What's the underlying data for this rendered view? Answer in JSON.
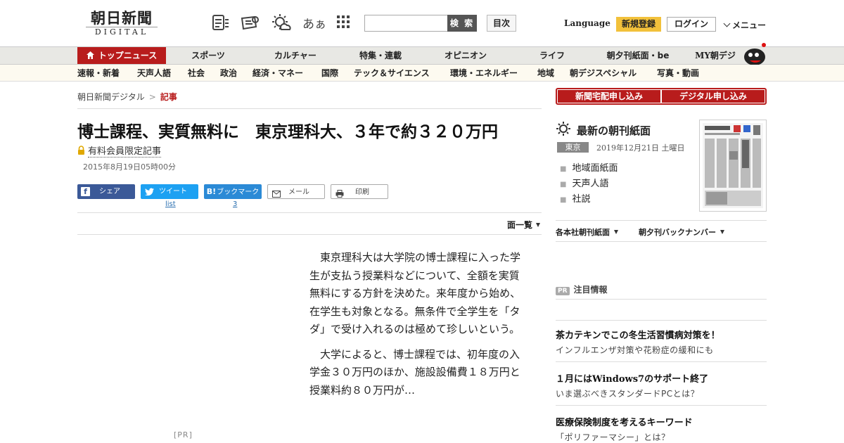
{
  "header": {
    "logo_jp": "朝日新聞",
    "logo_en": "DIGITAL",
    "search_placeholder": "",
    "search_button": "検 索",
    "toc_button": "目次",
    "language": "Language",
    "register": "新規登録",
    "login": "ログイン",
    "menu": "メニュー",
    "font_size_glyph": "あぁ"
  },
  "nav_primary": [
    {
      "label": "トップニュース",
      "active": true
    },
    {
      "label": "スポーツ"
    },
    {
      "label": "カルチャー"
    },
    {
      "label": "特集・連載"
    },
    {
      "label": "オピニオン"
    },
    {
      "label": "ライフ"
    },
    {
      "label": "朝夕刊紙面・be"
    },
    {
      "label": "MY朝デジ"
    }
  ],
  "nav_secondary": [
    "速報・新着",
    "天声人語",
    "社会",
    "政治",
    "経済・マネー",
    "国際",
    "テック＆サイエンス",
    "環境・エネルギー",
    "地域",
    "朝デジスペシャル",
    "写真・動画"
  ],
  "breadcrumb": {
    "home": "朝日新聞デジタル",
    "sep": ">",
    "current": "記事"
  },
  "article": {
    "title": "博士課程、実質無料に　東京理科大、３年で約３２０万円",
    "premium_label": "有料会員限定記事",
    "date": "2015年8月19日05時00分",
    "share": {
      "facebook": "シェア",
      "twitter": "ツイート",
      "twitter_sub": "list",
      "hatena": "ブックマーク",
      "hatena_icon": "B!",
      "hatena_count": "3",
      "mail": "メール",
      "print": "印刷"
    },
    "pages_label": "面一覧",
    "paragraphs": [
      "東京理科大は大学院の博士課程に入った学生が支払う授業料などについて、全額を実質無料にする方針を決めた。来年度から始め、在学生も対象となる。無条件で全学生を「タダ」で受け入れるのは極めて珍しいという。",
      "大学によると、博士課程では、初年度の入学金３０万円のほか、施設設備費１８万円と授業料約８０万円が…"
    ],
    "pr_label": "[PR]"
  },
  "sidebar": {
    "apply_home": "新聞宅配申し込み",
    "apply_digital": "デジタル申し込み",
    "paper_title": "最新の朝刊紙面",
    "region_badge": "東京",
    "paper_date": "2019年12月21日 土曜日",
    "paper_links": [
      "地域面紙面",
      "天声人語",
      "社説"
    ],
    "dropdown_1": "各本社朝刊紙面",
    "dropdown_2": "朝夕刊バックナンバー",
    "pr_badge": "PR",
    "pr_header": "注目情報",
    "ads": [
      {
        "title": "茶カテキンでこの冬生活習慣病対策を！",
        "sub": "インフルエンザ対策や花粉症の緩和にも"
      },
      {
        "title": "１月にはWindows7のサポート終了",
        "sub": "いま選ぶべきスタンダードPCとは？"
      },
      {
        "title": "医療保険制度を考えるキーワード",
        "sub": "「ポリファーマシー」とは？"
      }
    ]
  },
  "colors": {
    "brand_red": "#b81c1c",
    "register_yellow": "#f2c13b",
    "facebook": "#3b5998",
    "twitter": "#1da1f2",
    "hatena": "#2b8ad6"
  }
}
